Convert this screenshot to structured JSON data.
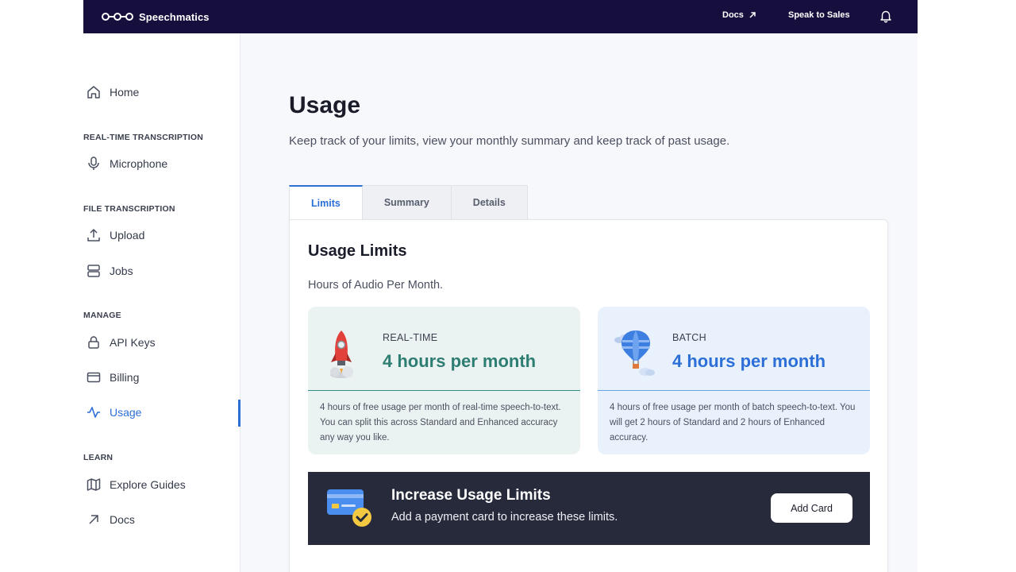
{
  "topbar": {
    "brand": "Speechmatics",
    "docs_label": "Docs",
    "sales_label": "Speak to Sales",
    "icons": [
      "logo-icon",
      "external-arrow-icon",
      "bell-icon"
    ]
  },
  "sidebar": {
    "home": "Home",
    "sections": {
      "realtime": "REAL-TIME TRANSCRIPTION",
      "file": "FILE TRANSCRIPTION",
      "manage": "MANAGE",
      "learn": "LEARN"
    },
    "items": {
      "microphone": "Microphone",
      "upload": "Upload",
      "jobs": "Jobs",
      "api_keys": "API Keys",
      "billing": "Billing",
      "usage": "Usage",
      "explore_guides": "Explore Guides",
      "docs": "Docs"
    },
    "active_item": "usage",
    "accent_color": "#2c6fd6"
  },
  "main": {
    "title": "Usage",
    "subtitle": "Keep track of your limits, view your monthly summary and keep track of past usage.",
    "tabs": [
      {
        "label": "Limits",
        "active": true
      },
      {
        "label": "Summary",
        "active": false
      },
      {
        "label": "Details",
        "active": false
      }
    ],
    "panel": {
      "title": "Usage Limits",
      "subtitle": "Hours of Audio Per Month.",
      "cards": {
        "realtime": {
          "kind": "REAL-TIME",
          "amount": "4 hours per month",
          "description": "4 hours of free usage per month of real-time speech-to-text. You can split this across Standard and Enhanced accuracy any way you like.",
          "icon": "rocket-icon",
          "color": "#2e7d73"
        },
        "batch": {
          "kind": "BATCH",
          "amount": "4 hours per month",
          "description": "4 hours of free usage per month of batch speech-to-text. You will get 2 hours of Standard and 2 hours of Enhanced accuracy.",
          "icon": "hot-air-balloon-icon",
          "color": "#2c6fd6"
        }
      },
      "upgrade": {
        "title": "Increase Usage Limits",
        "subtitle": "Add a payment card to increase these limits.",
        "button": "Add Card",
        "icon": "payment-card-check-icon",
        "background": "#262a3b"
      }
    }
  }
}
